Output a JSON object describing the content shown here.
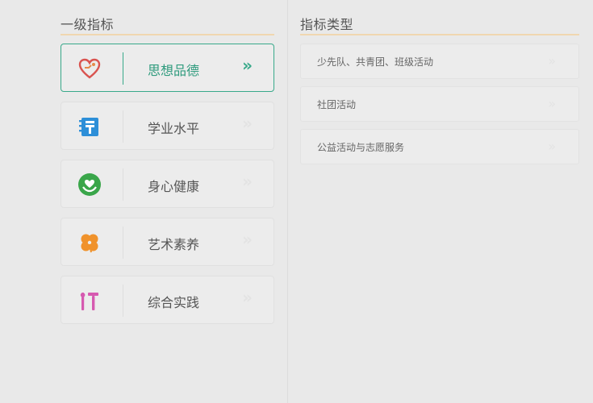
{
  "left_panel": {
    "title": "一级指标",
    "items": [
      {
        "label": "思想品德",
        "icon": "heart-hand-icon",
        "arrow": "»",
        "active": true,
        "color": "#d9534f"
      },
      {
        "label": "学业水平",
        "icon": "study-book-icon",
        "arrow": "»",
        "active": false,
        "color": "#2d8fd8"
      },
      {
        "label": "身心健康",
        "icon": "health-heart-icon",
        "arrow": "»",
        "active": false,
        "color": "#3aa64a"
      },
      {
        "label": "艺术素养",
        "icon": "flower-icon",
        "arrow": "»",
        "active": false,
        "color": "#f0922b"
      },
      {
        "label": "综合实践",
        "icon": "tools-icon",
        "arrow": "»",
        "active": false,
        "color": "#d65ab0"
      }
    ]
  },
  "right_panel": {
    "title": "指标类型",
    "items": [
      {
        "label": "少先队、共青团、班级活动",
        "arrow": "»"
      },
      {
        "label": "社团活动",
        "arrow": "»"
      },
      {
        "label": "公益活动与志愿服务",
        "arrow": "»"
      }
    ]
  },
  "colors": {
    "accent": "#38a98a",
    "underline": "#f0d7b0",
    "background": "#e9e9e9"
  }
}
